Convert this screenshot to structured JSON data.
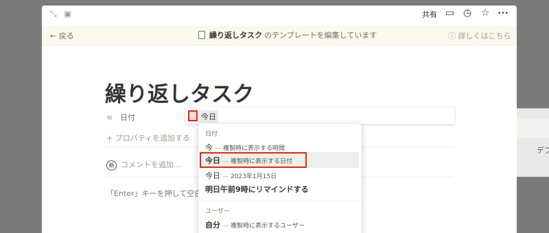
{
  "backdrop": {
    "right_text": "デフ"
  },
  "topbar": {
    "share_label": "共有",
    "icons": [
      "expand-icon",
      "sidebar-icon",
      "comment-icon",
      "clock-icon",
      "star-icon",
      "more-icon"
    ],
    "glyphs": {
      "expand": "⤡",
      "sidebar": "▣",
      "comment": "▭",
      "clock": "◷",
      "star": "☆",
      "more": "•••"
    }
  },
  "banner": {
    "back_label": "← 戻る",
    "template_name": "繰り返しタスク",
    "editing_text": "のテンプレートを編集しています",
    "learn_more": "ⓘ 詳しくはこちら"
  },
  "page": {
    "title": "繰り返しタスク",
    "property": {
      "icon": "≡",
      "name": "日付",
      "value": "今日"
    },
    "add_property": "+ プロパティを追加する",
    "comment_badge": "新",
    "comment_placeholder": "コメントを追加...",
    "hint": "「Enter」キーを押して空白"
  },
  "dropdown": {
    "date_header": "日付",
    "items": [
      {
        "label": "今",
        "desc": "複製時に表示する時間"
      },
      {
        "label": "今日",
        "desc": "複製時に表示する日付"
      },
      {
        "label": "今日",
        "desc": "2023年1月15日"
      },
      {
        "label": "明日午前9時にリマインドする",
        "desc": ""
      }
    ],
    "dash": "—",
    "user_header": "ユーザー",
    "user_item": {
      "label": "自分",
      "desc": "複製時に表示するユーザー"
    }
  },
  "colors": {
    "highlight": "#e0280f",
    "banner_bg": "#fbf8ee"
  }
}
